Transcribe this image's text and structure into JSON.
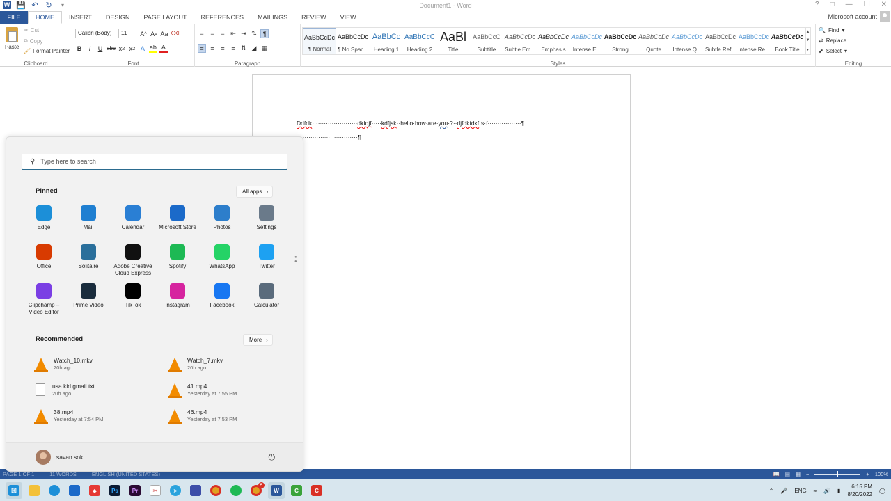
{
  "word": {
    "title": "Document1 - Word",
    "tabs": [
      "FILE",
      "HOME",
      "INSERT",
      "DESIGN",
      "PAGE LAYOUT",
      "REFERENCES",
      "MAILINGS",
      "REVIEW",
      "VIEW"
    ],
    "account": "Microsoft account",
    "clipboard": {
      "paste": "Paste",
      "cut": "Cut",
      "copy": "Copy",
      "format_painter": "Format Painter",
      "label": "Clipboard"
    },
    "font": {
      "name": "Calibri (Body)",
      "size": "11",
      "label": "Font"
    },
    "paragraph": {
      "label": "Paragraph"
    },
    "styles": {
      "label": "Styles",
      "items": [
        {
          "preview": "AaBbCcDc",
          "name": "¶ Normal"
        },
        {
          "preview": "AaBbCcDc",
          "name": "¶ No Spac..."
        },
        {
          "preview": "AaBbCc",
          "name": "Heading 1"
        },
        {
          "preview": "AaBbCcC",
          "name": "Heading 2"
        },
        {
          "preview": "AaBl",
          "name": "Title"
        },
        {
          "preview": "AaBbCcC",
          "name": "Subtitle"
        },
        {
          "preview": "AaBbCcDc",
          "name": "Subtle Em..."
        },
        {
          "preview": "AaBbCcDc",
          "name": "Emphasis"
        },
        {
          "preview": "AaBbCcDc",
          "name": "Intense E..."
        },
        {
          "preview": "AaBbCcDc",
          "name": "Strong"
        },
        {
          "preview": "AaBbCcDc",
          "name": "Quote"
        },
        {
          "preview": "AaBbCcDc",
          "name": "Intense Q..."
        },
        {
          "preview": "AaBbCcDc",
          "name": "Subtle Ref..."
        },
        {
          "preview": "AaBbCcDc",
          "name": "Intense Re..."
        },
        {
          "preview": "AaBbCcDc",
          "name": "Book Title"
        }
      ]
    },
    "editing": {
      "find": "Find",
      "replace": "Replace",
      "select": "Select",
      "label": "Editing"
    },
    "document": {
      "line1_a": "Ddfdk",
      "line1_b": "·······················",
      "line1_c": "dkfdjf",
      "line1_d": "·····",
      "line1_e": "kdfjsk",
      "line1_f": "··hello·how·are·",
      "line1_g": "you",
      "line1_h": "·?··",
      "line1_i": "djfdkfdkf",
      "line1_j": "·s·f·················¶",
      "line2": "·······························¶"
    },
    "status": {
      "page": "PAGE 1 OF 1",
      "words": "11 WORDS",
      "lang": "ENGLISH (UNITED STATES)",
      "zoom": "100%",
      "zoom_fraction": 0.5
    }
  },
  "start_menu": {
    "search_placeholder": "Type here to search",
    "pinned_title": "Pinned",
    "all_apps": "All apps",
    "pinned": [
      {
        "name": "Edge",
        "icon": "edge-icon",
        "color": "#1c8fd8"
      },
      {
        "name": "Mail",
        "icon": "mail-icon",
        "color": "#1f7fd1"
      },
      {
        "name": "Calendar",
        "icon": "calendar-icon",
        "color": "#2a7fd4"
      },
      {
        "name": "Microsoft Store",
        "icon": "store-icon",
        "color": "#1b6ac9"
      },
      {
        "name": "Photos",
        "icon": "photos-icon",
        "color": "#2d7ecb"
      },
      {
        "name": "Settings",
        "icon": "gear-icon",
        "color": "#6a7a8a"
      },
      {
        "name": "Office",
        "icon": "office-icon",
        "color": "#d83b01"
      },
      {
        "name": "Solitaire",
        "icon": "cards-icon",
        "color": "#2a6f9b"
      },
      {
        "name": "Adobe Creative Cloud Express",
        "icon": "adobe-icon",
        "color": "#111111"
      },
      {
        "name": "Spotify",
        "icon": "spotify-icon",
        "color": "#1db954"
      },
      {
        "name": "WhatsApp",
        "icon": "whatsapp-icon",
        "color": "#25d366"
      },
      {
        "name": "Twitter",
        "icon": "twitter-icon",
        "color": "#1da1f2"
      },
      {
        "name": "Clipchamp – Video Editor",
        "icon": "clipchamp-icon",
        "color": "#7b3fe4"
      },
      {
        "name": "Prime Video",
        "icon": "prime-video-icon",
        "color": "#1a2c3d"
      },
      {
        "name": "TikTok",
        "icon": "tiktok-icon",
        "color": "#000000"
      },
      {
        "name": "Instagram",
        "icon": "instagram-icon",
        "color": "#d6249f"
      },
      {
        "name": "Facebook",
        "icon": "facebook-icon",
        "color": "#1877f2"
      },
      {
        "name": "Calculator",
        "icon": "calculator-icon",
        "color": "#5a6b7c"
      }
    ],
    "recommended_title": "Recommended",
    "more": "More",
    "recommended": [
      {
        "name": "Watch_10.mkv",
        "time": "20h ago",
        "icon": "vlc-icon"
      },
      {
        "name": "Watch_7.mkv",
        "time": "20h ago",
        "icon": "vlc-icon"
      },
      {
        "name": "usa kid gmail.txt",
        "time": "20h ago",
        "icon": "text-file-icon"
      },
      {
        "name": "41.mp4",
        "time": "Yesterday at 7:55 PM",
        "icon": "vlc-icon"
      },
      {
        "name": "38.mp4",
        "time": "Yesterday at 7:54 PM",
        "icon": "vlc-icon"
      },
      {
        "name": "46.mp4",
        "time": "Yesterday at 7:53 PM",
        "icon": "vlc-icon"
      }
    ],
    "user": "savan sok"
  },
  "taskbar": {
    "lang": "ENG",
    "time": "6:15 PM",
    "date": "8/20/2022",
    "badge": "5"
  }
}
